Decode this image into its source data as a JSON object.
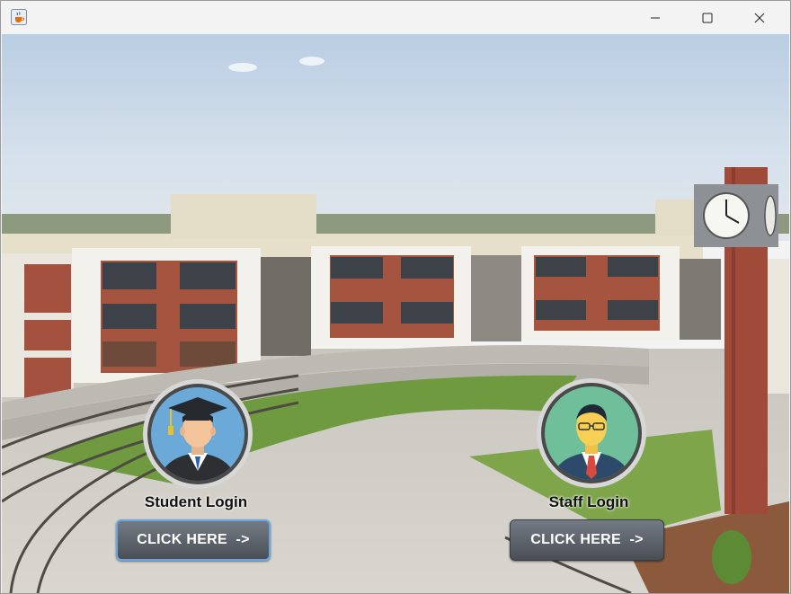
{
  "window": {
    "app_icon": "java-cup-icon",
    "controls": [
      "minimize-icon",
      "maximize-icon",
      "close-icon"
    ]
  },
  "student": {
    "avatar_icon": "graduate-student-avatar-icon",
    "label": "Student Login",
    "button_label": "CLICK HERE  ->"
  },
  "staff": {
    "avatar_icon": "staff-businessman-avatar-icon",
    "label": "Staff Login",
    "button_label": "CLICK HERE  ->"
  },
  "colors": {
    "sky": "#c9d7e6",
    "brick": "#9b4a3c",
    "grass": "#6f9a3f",
    "button": "#5b6168",
    "focus_ring": "#6aa6e3"
  }
}
